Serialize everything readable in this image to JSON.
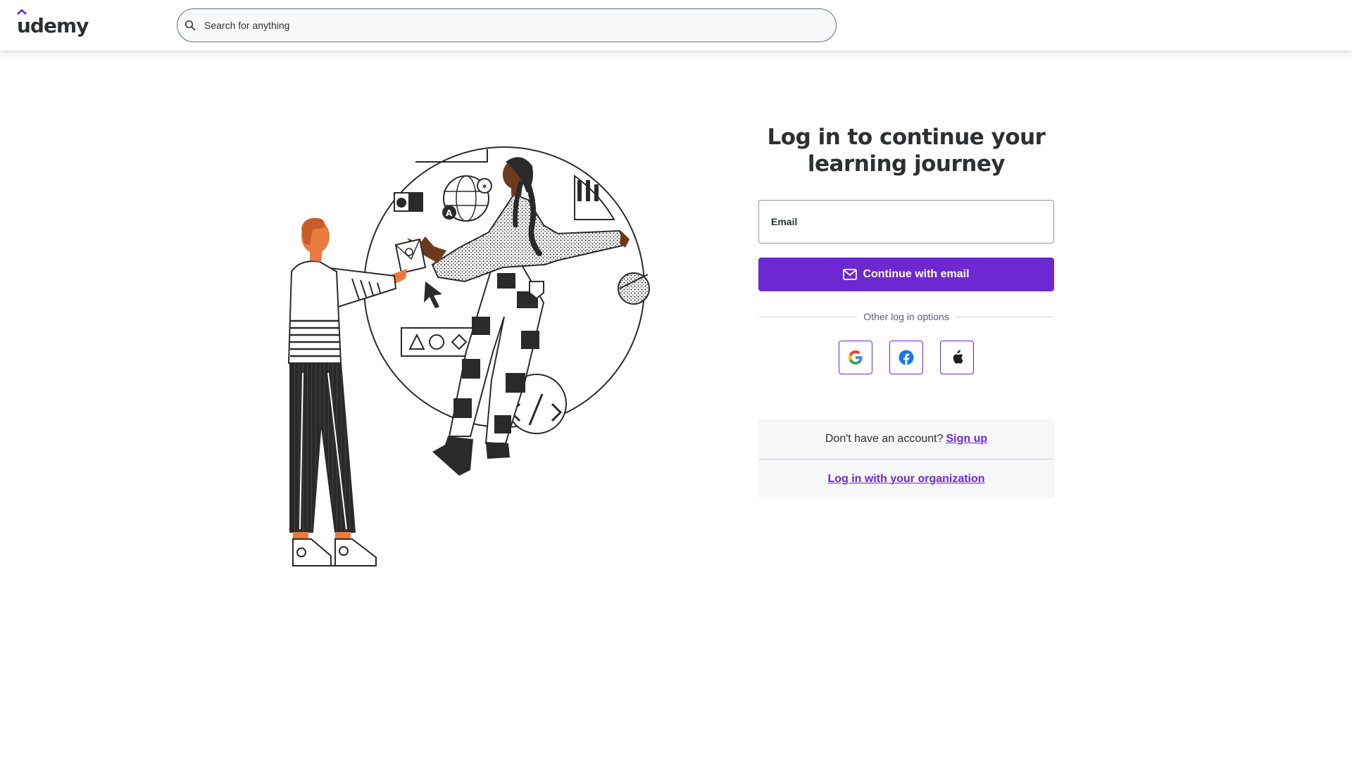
{
  "header": {
    "logo_text": "udemy",
    "search": {
      "placeholder": "Search for anything",
      "value": ""
    }
  },
  "login": {
    "title": "Log in to continue your learning journey",
    "email_label": "Email",
    "continue_label": "Continue with email",
    "divider_text": "Other log in options",
    "social": [
      {
        "name": "Google",
        "icon": "google-icon"
      },
      {
        "name": "Facebook",
        "icon": "facebook-icon"
      },
      {
        "name": "Apple",
        "icon": "apple-icon"
      }
    ],
    "signup_prompt": "Don't have an account?",
    "signup_link": "Sign up",
    "org_link": "Log in with your organization"
  },
  "colors": {
    "brand": "#6d28d2",
    "text": "#2d2f31",
    "panel_bg": "#f6f7f9"
  }
}
